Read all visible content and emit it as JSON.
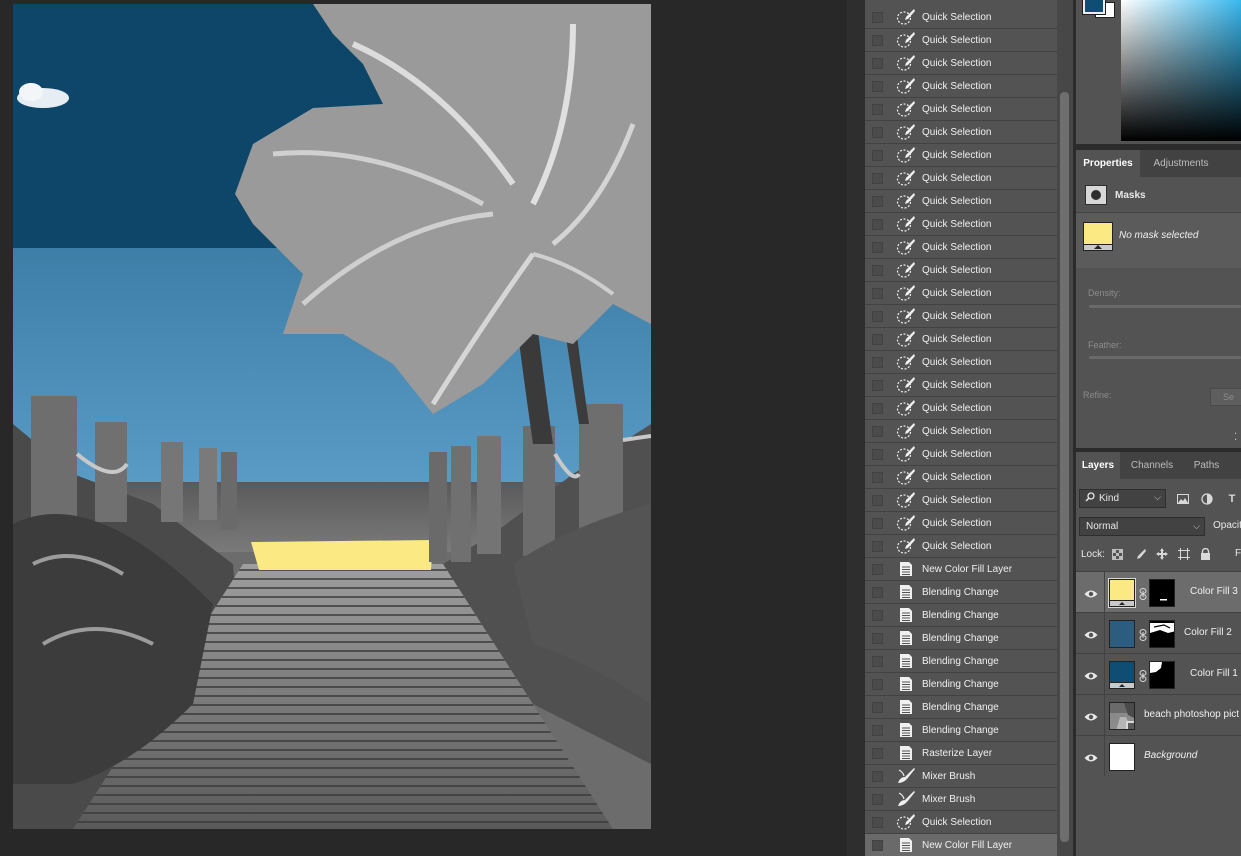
{
  "history": {
    "items": [
      {
        "label": "Quick Selection",
        "icon": "quick-selection-icon"
      },
      {
        "label": "Quick Selection",
        "icon": "quick-selection-icon"
      },
      {
        "label": "Quick Selection",
        "icon": "quick-selection-icon"
      },
      {
        "label": "Quick Selection",
        "icon": "quick-selection-icon"
      },
      {
        "label": "Quick Selection",
        "icon": "quick-selection-icon"
      },
      {
        "label": "Quick Selection",
        "icon": "quick-selection-icon"
      },
      {
        "label": "Quick Selection",
        "icon": "quick-selection-icon"
      },
      {
        "label": "Quick Selection",
        "icon": "quick-selection-icon"
      },
      {
        "label": "Quick Selection",
        "icon": "quick-selection-icon"
      },
      {
        "label": "Quick Selection",
        "icon": "quick-selection-icon"
      },
      {
        "label": "Quick Selection",
        "icon": "quick-selection-icon"
      },
      {
        "label": "Quick Selection",
        "icon": "quick-selection-icon"
      },
      {
        "label": "Quick Selection",
        "icon": "quick-selection-icon"
      },
      {
        "label": "Quick Selection",
        "icon": "quick-selection-icon"
      },
      {
        "label": "Quick Selection",
        "icon": "quick-selection-icon"
      },
      {
        "label": "Quick Selection",
        "icon": "quick-selection-icon"
      },
      {
        "label": "Quick Selection",
        "icon": "quick-selection-icon"
      },
      {
        "label": "Quick Selection",
        "icon": "quick-selection-icon"
      },
      {
        "label": "Quick Selection",
        "icon": "quick-selection-icon"
      },
      {
        "label": "Quick Selection",
        "icon": "quick-selection-icon"
      },
      {
        "label": "Quick Selection",
        "icon": "quick-selection-icon"
      },
      {
        "label": "Quick Selection",
        "icon": "quick-selection-icon"
      },
      {
        "label": "Quick Selection",
        "icon": "quick-selection-icon"
      },
      {
        "label": "Quick Selection",
        "icon": "quick-selection-icon"
      },
      {
        "label": "New Color Fill Layer",
        "icon": "history-state-icon"
      },
      {
        "label": "Blending Change",
        "icon": "history-state-icon"
      },
      {
        "label": "Blending Change",
        "icon": "history-state-icon"
      },
      {
        "label": "Blending Change",
        "icon": "history-state-icon"
      },
      {
        "label": "Blending Change",
        "icon": "history-state-icon"
      },
      {
        "label": "Blending Change",
        "icon": "history-state-icon"
      },
      {
        "label": "Blending Change",
        "icon": "history-state-icon"
      },
      {
        "label": "Blending Change",
        "icon": "history-state-icon"
      },
      {
        "label": "Rasterize Layer",
        "icon": "history-state-icon"
      },
      {
        "label": "Mixer Brush",
        "icon": "mixer-brush-icon"
      },
      {
        "label": "Mixer Brush",
        "icon": "mixer-brush-icon"
      },
      {
        "label": "Quick Selection",
        "icon": "quick-selection-icon"
      },
      {
        "label": "New Color Fill Layer",
        "icon": "history-state-icon",
        "current": true
      }
    ]
  },
  "color": {
    "foreground": "#0f4d72",
    "background": "#ffffff",
    "picker_hue": "#35b7ee"
  },
  "properties": {
    "tabs": [
      {
        "label": "Properties",
        "active": true
      },
      {
        "label": "Adjustments",
        "active": false
      }
    ],
    "section": "Masks",
    "mask_status": "No mask selected",
    "density_label": "Density:",
    "feather_label": "Feather:",
    "refine_label": "Refine:",
    "select_button": "Se"
  },
  "layers_panel": {
    "tabs": [
      {
        "label": "Layers",
        "active": true
      },
      {
        "label": "Channels",
        "active": false
      },
      {
        "label": "Paths",
        "active": false
      }
    ],
    "filter_kind": "Kind",
    "filter_type_glyph": "T",
    "blend_mode": "Normal",
    "opacity_label": "Opacit",
    "lock_label": "Lock:",
    "fill_label": "F",
    "layers": [
      {
        "name": "Color Fill 3",
        "color": "#fbe983",
        "selected": true,
        "has_mask": true,
        "italic": false
      },
      {
        "name": "Color Fill 2",
        "color": "#2c5d80",
        "selected": false,
        "has_mask": true,
        "italic": false
      },
      {
        "name": "Color Fill 1",
        "color": "#0f4d72",
        "selected": false,
        "has_mask": true,
        "italic": false
      },
      {
        "name": "beach photoshop pict",
        "color": "#8a8a8a",
        "selected": false,
        "has_mask": false,
        "italic": false
      },
      {
        "name": "Background",
        "color": "#ffffff",
        "selected": false,
        "has_mask": false,
        "italic": true
      }
    ]
  },
  "canvas": {
    "sky_color": "#0d4668",
    "sky_light_color": "#4f8db6",
    "fill_color": "#fbe983"
  }
}
